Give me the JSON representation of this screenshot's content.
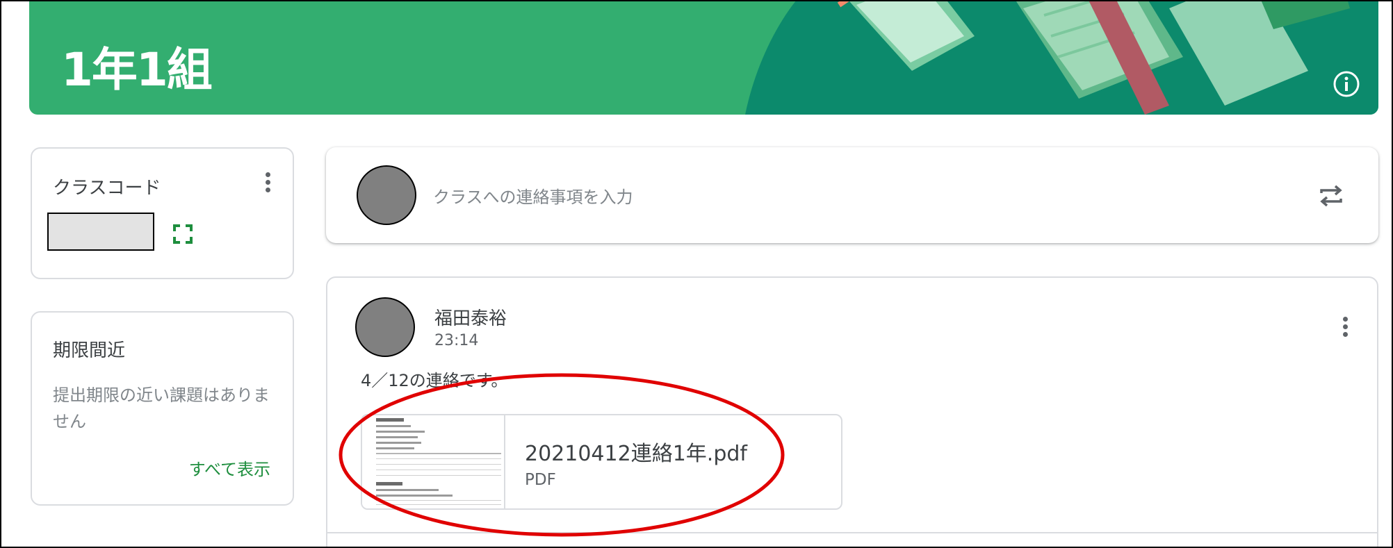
{
  "banner": {
    "class_name": "1年1組",
    "colors": {
      "base": "#33ae70",
      "dark": "#0c8a6c"
    }
  },
  "class_code_card": {
    "title": "クラスコード"
  },
  "upcoming_card": {
    "title": "期限間近",
    "empty_message": "提出期限の近い課題はありません",
    "view_all_label": "すべて表示"
  },
  "compose": {
    "placeholder": "クラスへの連絡事項を入力"
  },
  "post": {
    "author": "福田泰裕",
    "time": "23:14",
    "body": "4／12の連絡です。",
    "attachment": {
      "file_name": "20210412連絡1年.pdf",
      "file_type": "PDF"
    }
  },
  "icons": {
    "info": "info-icon",
    "menu": "more-vert-icon",
    "fullscreen": "fullscreen-icon",
    "repost": "repost-icon"
  },
  "colors": {
    "accent_green": "#1e8e3e",
    "annotation_red": "#e00000"
  }
}
